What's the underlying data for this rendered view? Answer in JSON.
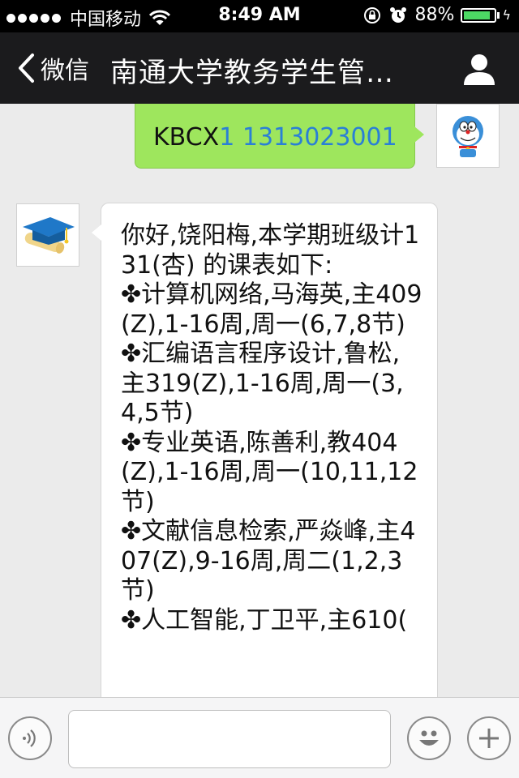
{
  "status_bar": {
    "carrier": "中国移动",
    "time": "8:49 AM",
    "battery_percent": "88%",
    "battery_level": 0.88,
    "icons": [
      "signal-dots",
      "wifi-icon",
      "rotation-lock-icon",
      "alarm-icon",
      "battery-icon",
      "charging-icon"
    ]
  },
  "nav": {
    "back_label": "微信",
    "title": "南通大学教务学生管…",
    "icons": [
      "back-chevron-icon",
      "profile-icon"
    ]
  },
  "messages": [
    {
      "direction": "outgoing",
      "command": "KBCX",
      "number": "1 1313023001",
      "avatar_icon": "doraemon-avatar"
    },
    {
      "direction": "incoming",
      "avatar_icon": "graduation-cap-avatar",
      "text": "你好,饶阳梅,本学期班级计131(杏) 的课表如下:\n✤计算机网络,马海英,主409(Z),1-16周,周一(6,7,8节)\n✤汇编语言程序设计,鲁松,主319(Z),1-16周,周一(3,4,5节)\n✤专业英语,陈善利,教404(Z),1-16周,周一(10,11,12节)\n✤文献信息检索,严焱峰,主407(Z),9-16周,周二(1,2,3节)\n✤人工智能,丁卫平,主610("
    }
  ],
  "input_bar": {
    "placeholder": "",
    "icons": [
      "voice-icon",
      "emoji-icon",
      "plus-icon"
    ]
  },
  "colors": {
    "outgoing_bubble": "#9ee65d",
    "link_blue": "#2a7fd6",
    "nav_background": "#1b1b1d",
    "chat_background": "#ebebeb"
  }
}
